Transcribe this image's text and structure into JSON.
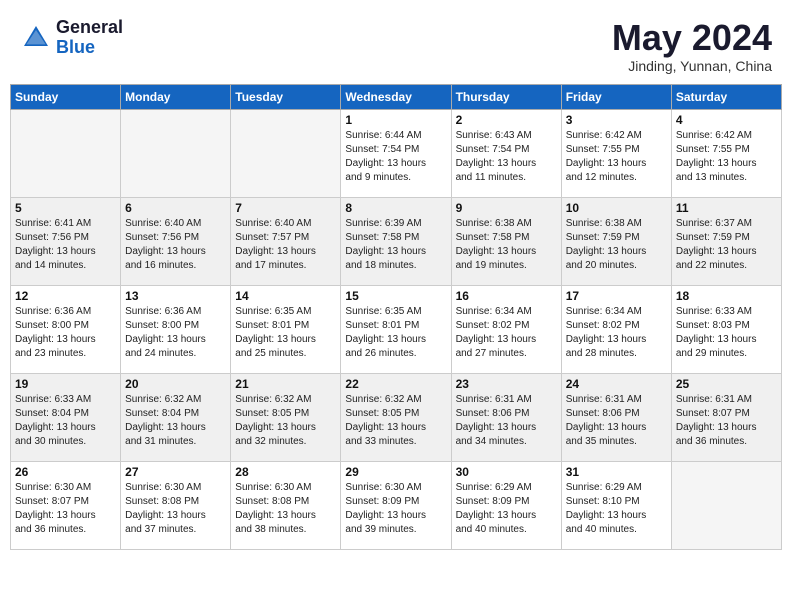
{
  "header": {
    "logo_general": "General",
    "logo_blue": "Blue",
    "month_year": "May 2024",
    "location": "Jinding, Yunnan, China"
  },
  "weekdays": [
    "Sunday",
    "Monday",
    "Tuesday",
    "Wednesday",
    "Thursday",
    "Friday",
    "Saturday"
  ],
  "weeks": [
    [
      {
        "day": "",
        "info": ""
      },
      {
        "day": "",
        "info": ""
      },
      {
        "day": "",
        "info": ""
      },
      {
        "day": "1",
        "info": "Sunrise: 6:44 AM\nSunset: 7:54 PM\nDaylight: 13 hours\nand 9 minutes."
      },
      {
        "day": "2",
        "info": "Sunrise: 6:43 AM\nSunset: 7:54 PM\nDaylight: 13 hours\nand 11 minutes."
      },
      {
        "day": "3",
        "info": "Sunrise: 6:42 AM\nSunset: 7:55 PM\nDaylight: 13 hours\nand 12 minutes."
      },
      {
        "day": "4",
        "info": "Sunrise: 6:42 AM\nSunset: 7:55 PM\nDaylight: 13 hours\nand 13 minutes."
      }
    ],
    [
      {
        "day": "5",
        "info": "Sunrise: 6:41 AM\nSunset: 7:56 PM\nDaylight: 13 hours\nand 14 minutes."
      },
      {
        "day": "6",
        "info": "Sunrise: 6:40 AM\nSunset: 7:56 PM\nDaylight: 13 hours\nand 16 minutes."
      },
      {
        "day": "7",
        "info": "Sunrise: 6:40 AM\nSunset: 7:57 PM\nDaylight: 13 hours\nand 17 minutes."
      },
      {
        "day": "8",
        "info": "Sunrise: 6:39 AM\nSunset: 7:58 PM\nDaylight: 13 hours\nand 18 minutes."
      },
      {
        "day": "9",
        "info": "Sunrise: 6:38 AM\nSunset: 7:58 PM\nDaylight: 13 hours\nand 19 minutes."
      },
      {
        "day": "10",
        "info": "Sunrise: 6:38 AM\nSunset: 7:59 PM\nDaylight: 13 hours\nand 20 minutes."
      },
      {
        "day": "11",
        "info": "Sunrise: 6:37 AM\nSunset: 7:59 PM\nDaylight: 13 hours\nand 22 minutes."
      }
    ],
    [
      {
        "day": "12",
        "info": "Sunrise: 6:36 AM\nSunset: 8:00 PM\nDaylight: 13 hours\nand 23 minutes."
      },
      {
        "day": "13",
        "info": "Sunrise: 6:36 AM\nSunset: 8:00 PM\nDaylight: 13 hours\nand 24 minutes."
      },
      {
        "day": "14",
        "info": "Sunrise: 6:35 AM\nSunset: 8:01 PM\nDaylight: 13 hours\nand 25 minutes."
      },
      {
        "day": "15",
        "info": "Sunrise: 6:35 AM\nSunset: 8:01 PM\nDaylight: 13 hours\nand 26 minutes."
      },
      {
        "day": "16",
        "info": "Sunrise: 6:34 AM\nSunset: 8:02 PM\nDaylight: 13 hours\nand 27 minutes."
      },
      {
        "day": "17",
        "info": "Sunrise: 6:34 AM\nSunset: 8:02 PM\nDaylight: 13 hours\nand 28 minutes."
      },
      {
        "day": "18",
        "info": "Sunrise: 6:33 AM\nSunset: 8:03 PM\nDaylight: 13 hours\nand 29 minutes."
      }
    ],
    [
      {
        "day": "19",
        "info": "Sunrise: 6:33 AM\nSunset: 8:04 PM\nDaylight: 13 hours\nand 30 minutes."
      },
      {
        "day": "20",
        "info": "Sunrise: 6:32 AM\nSunset: 8:04 PM\nDaylight: 13 hours\nand 31 minutes."
      },
      {
        "day": "21",
        "info": "Sunrise: 6:32 AM\nSunset: 8:05 PM\nDaylight: 13 hours\nand 32 minutes."
      },
      {
        "day": "22",
        "info": "Sunrise: 6:32 AM\nSunset: 8:05 PM\nDaylight: 13 hours\nand 33 minutes."
      },
      {
        "day": "23",
        "info": "Sunrise: 6:31 AM\nSunset: 8:06 PM\nDaylight: 13 hours\nand 34 minutes."
      },
      {
        "day": "24",
        "info": "Sunrise: 6:31 AM\nSunset: 8:06 PM\nDaylight: 13 hours\nand 35 minutes."
      },
      {
        "day": "25",
        "info": "Sunrise: 6:31 AM\nSunset: 8:07 PM\nDaylight: 13 hours\nand 36 minutes."
      }
    ],
    [
      {
        "day": "26",
        "info": "Sunrise: 6:30 AM\nSunset: 8:07 PM\nDaylight: 13 hours\nand 36 minutes."
      },
      {
        "day": "27",
        "info": "Sunrise: 6:30 AM\nSunset: 8:08 PM\nDaylight: 13 hours\nand 37 minutes."
      },
      {
        "day": "28",
        "info": "Sunrise: 6:30 AM\nSunset: 8:08 PM\nDaylight: 13 hours\nand 38 minutes."
      },
      {
        "day": "29",
        "info": "Sunrise: 6:30 AM\nSunset: 8:09 PM\nDaylight: 13 hours\nand 39 minutes."
      },
      {
        "day": "30",
        "info": "Sunrise: 6:29 AM\nSunset: 8:09 PM\nDaylight: 13 hours\nand 40 minutes."
      },
      {
        "day": "31",
        "info": "Sunrise: 6:29 AM\nSunset: 8:10 PM\nDaylight: 13 hours\nand 40 minutes."
      },
      {
        "day": "",
        "info": ""
      }
    ]
  ]
}
